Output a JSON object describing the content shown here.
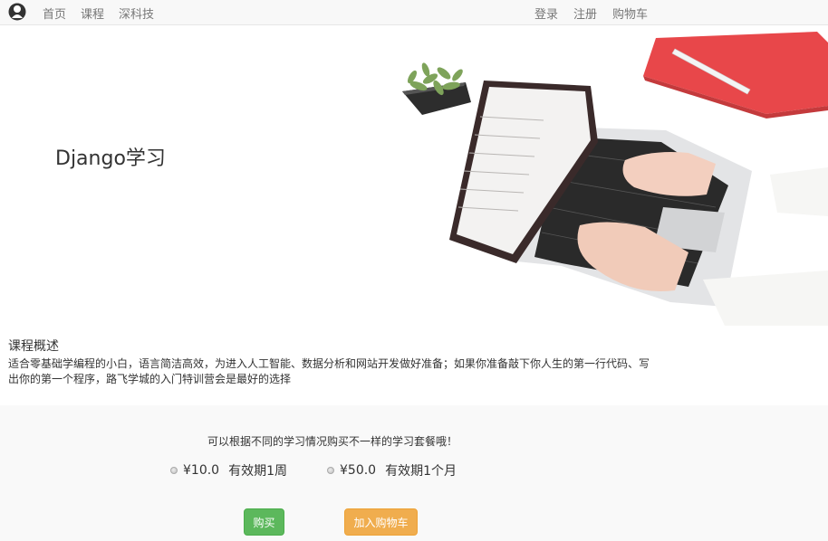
{
  "nav": {
    "home": "首页",
    "course": "课程",
    "tech": "深科技",
    "login": "登录",
    "register": "注册",
    "cart": "购物车"
  },
  "hero": {
    "title": "Django学习"
  },
  "overview": {
    "title": "课程概述",
    "description": "适合零基础学编程的小白，语言简洁高效，为进入人工智能、数据分析和网站开发做好准备；如果你准备敲下你人生的第一行代码、写出你的第一个程序，路飞学城的入门特训营会是最好的选择"
  },
  "purchase": {
    "hint": "可以根据不同的学习情况购买不一样的学习套餐哦！",
    "plans": [
      {
        "price": "¥10.0",
        "validity": "有效期1周"
      },
      {
        "price": "¥50.0",
        "validity": "有效期1个月"
      }
    ],
    "buy_label": "购买",
    "cart_label": "加入购物车"
  },
  "colors": {
    "buy_button": "#5cb85c",
    "cart_button": "#f0ad4e",
    "navbar": "#f8f8f8"
  }
}
